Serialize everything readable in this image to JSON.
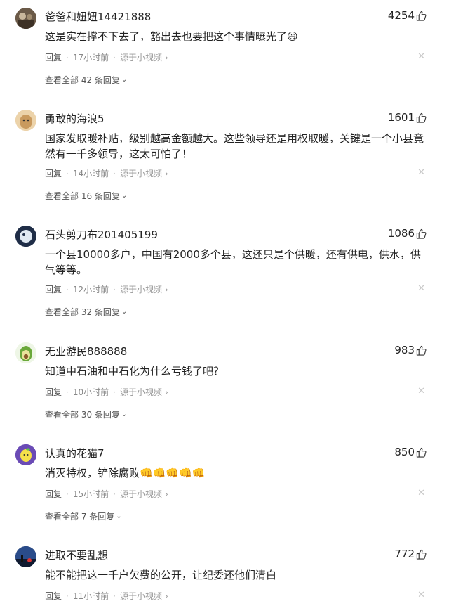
{
  "comments": [
    {
      "username": "爸爸和妞妞14421888",
      "likes": "4254",
      "text": "这是实在撑不下去了，豁出去也要把这个事情曝光了😄",
      "reply": "回复",
      "time": "17小时前",
      "source": "源于小视频",
      "view_replies": "查看全部 42 条回复",
      "avatar_color": "#5a4a3a"
    },
    {
      "username": "勇敢的海浪5",
      "likes": "1601",
      "text": "国家发取暖补贴，级别越高金额越大。这些领导还是用权取暖，关键是一个小县竟然有一千多领导，这太可怕了！",
      "reply": "回复",
      "time": "14小时前",
      "source": "源于小视频",
      "view_replies": "查看全部 16 条回复",
      "avatar_color": "#e6c79a"
    },
    {
      "username": "石头剪刀布201405199",
      "likes": "1086",
      "text": "一个县10000多户，中国有2000多个县，这还只是个供暖，还有供电，供水，供气等等。",
      "reply": "回复",
      "time": "12小时前",
      "source": "源于小视频",
      "view_replies": "查看全部 32 条回复",
      "avatar_color": "#2b3b5a"
    },
    {
      "username": "无业游民888888",
      "likes": "983",
      "text": "知道中石油和中石化为什么亏钱了吧？",
      "reply": "回复",
      "time": "10小时前",
      "source": "源于小视频",
      "view_replies": "查看全部 30 条回复",
      "avatar_color": "#8bc34a"
    },
    {
      "username": "认真的花猫7",
      "likes": "850",
      "text": "消灭特权，铲除腐败👊👊👊👊👊",
      "reply": "回复",
      "time": "15小时前",
      "source": "源于小视频",
      "view_replies": "查看全部 7 条回复",
      "avatar_color": "#7e57c2"
    },
    {
      "username": "进取不要乱想",
      "likes": "772",
      "text": "能不能把这一千户欠费的公开，让纪委还他们清白",
      "reply": "回复",
      "time": "11小时前",
      "source": "源于小视频",
      "view_replies": "",
      "avatar_color": "#1a2a4a"
    }
  ]
}
